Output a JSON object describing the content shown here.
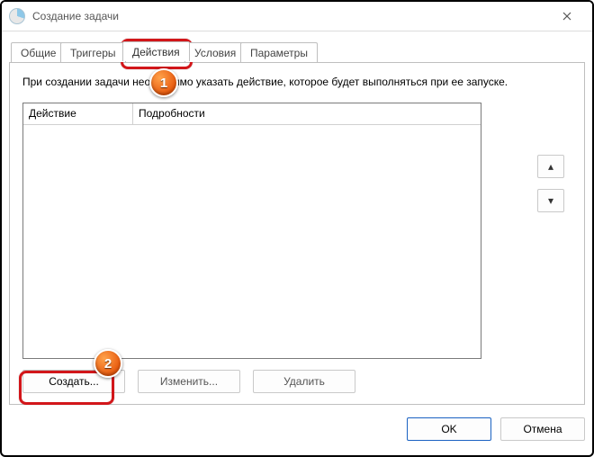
{
  "window": {
    "title": "Создание задачи",
    "close": "✕"
  },
  "tabs": {
    "t0": "Общие",
    "t1": "Триггеры",
    "t2": "Действия",
    "t3": "Условия",
    "t4": "Параметры"
  },
  "panel": {
    "instruction": "При создании задачи необходимо указать действие, которое будет выполняться при ее запуске.",
    "col_action": "Действие",
    "col_details": "Подробности"
  },
  "buttons": {
    "create": "Создать...",
    "edit": "Изменить...",
    "delete": "Удалить",
    "ok": "OK",
    "cancel": "Отмена",
    "up": "▴",
    "down": "▾"
  },
  "callouts": {
    "one": "1",
    "two": "2"
  }
}
